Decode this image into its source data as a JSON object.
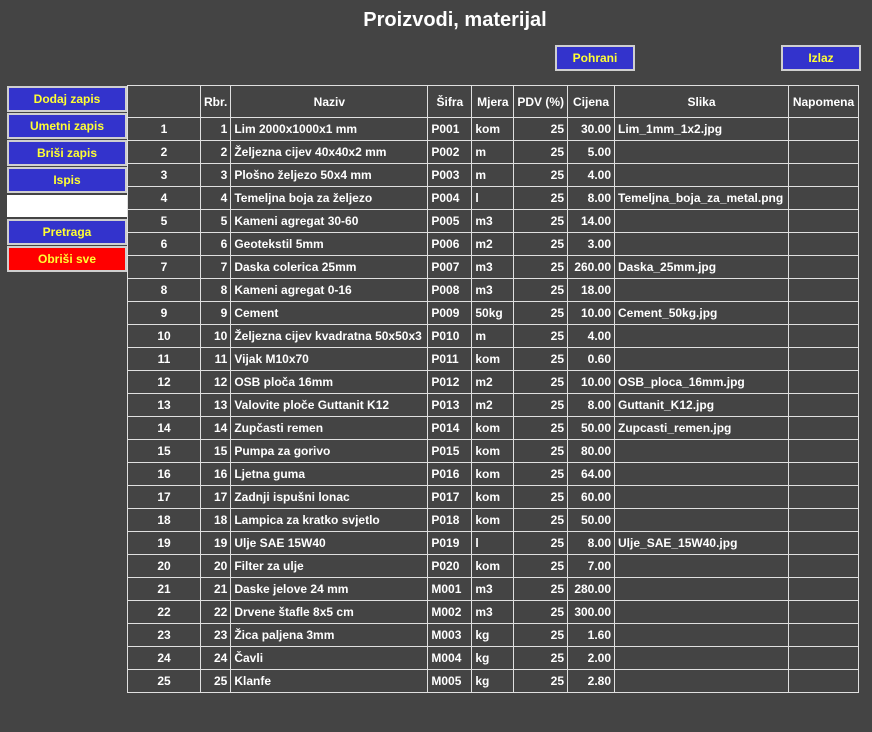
{
  "title": "Proizvodi, materijal",
  "buttons": {
    "save": "Pohrani",
    "exit": "Izlaz"
  },
  "sidebar": {
    "add": "Dodaj zapis",
    "insert": "Umetni zapis",
    "delete": "Briši zapis",
    "print": "Ispis",
    "search_value": "",
    "search": "Pretraga",
    "clear_all": "Obriši sve"
  },
  "colors": {
    "background": "#444444",
    "button": "#3333cc",
    "button_text": "#ffff33",
    "danger": "#ff0000"
  },
  "table": {
    "headers": [
      "",
      "Rbr.",
      "Naziv",
      "Šifra",
      "Mjera",
      "PDV (%)",
      "Cijena",
      "Slika",
      "Napomena"
    ],
    "rows": [
      [
        "1",
        "1",
        "Lim 2000x1000x1 mm",
        "P001",
        "kom",
        "25",
        "30.00",
        "Lim_1mm_1x2.jpg",
        ""
      ],
      [
        "2",
        "2",
        "Željezna cijev 40x40x2 mm",
        "P002",
        "m",
        "25",
        "5.00",
        "",
        ""
      ],
      [
        "3",
        "3",
        "Plošno željezo 50x4 mm",
        "P003",
        "m",
        "25",
        "4.00",
        "",
        ""
      ],
      [
        "4",
        "4",
        "Temeljna boja za željezo",
        "P004",
        "l",
        "25",
        "8.00",
        "Temeljna_boja_za_metal.png",
        ""
      ],
      [
        "5",
        "5",
        "Kameni agregat 30-60",
        "P005",
        "m3",
        "25",
        "14.00",
        "",
        ""
      ],
      [
        "6",
        "6",
        "Geotekstil 5mm",
        "P006",
        "m2",
        "25",
        "3.00",
        "",
        ""
      ],
      [
        "7",
        "7",
        "Daska colerica 25mm",
        "P007",
        "m3",
        "25",
        "260.00",
        "Daska_25mm.jpg",
        ""
      ],
      [
        "8",
        "8",
        "Kameni agregat 0-16",
        "P008",
        "m3",
        "25",
        "18.00",
        "",
        ""
      ],
      [
        "9",
        "9",
        "Cement",
        "P009",
        "50kg",
        "25",
        "10.00",
        "Cement_50kg.jpg",
        ""
      ],
      [
        "10",
        "10",
        "Željezna cijev kvadratna 50x50x3",
        "P010",
        "m",
        "25",
        "4.00",
        "",
        ""
      ],
      [
        "11",
        "11",
        "Vijak M10x70",
        "P011",
        "kom",
        "25",
        "0.60",
        "",
        ""
      ],
      [
        "12",
        "12",
        "OSB ploča 16mm",
        "P012",
        "m2",
        "25",
        "10.00",
        "OSB_ploca_16mm.jpg",
        ""
      ],
      [
        "13",
        "13",
        "Valovite ploče Guttanit K12",
        "P013",
        "m2",
        "25",
        "8.00",
        "Guttanit_K12.jpg",
        ""
      ],
      [
        "14",
        "14",
        "Zupčasti remen",
        "P014",
        "kom",
        "25",
        "50.00",
        "Zupcasti_remen.jpg",
        ""
      ],
      [
        "15",
        "15",
        "Pumpa za gorivo",
        "P015",
        "kom",
        "25",
        "80.00",
        "",
        ""
      ],
      [
        "16",
        "16",
        "Ljetna guma",
        "P016",
        "kom",
        "25",
        "64.00",
        "",
        ""
      ],
      [
        "17",
        "17",
        "Zadnji ispušni lonac",
        "P017",
        "kom",
        "25",
        "60.00",
        "",
        ""
      ],
      [
        "18",
        "18",
        "Lampica za kratko svjetlo",
        "P018",
        "kom",
        "25",
        "50.00",
        "",
        ""
      ],
      [
        "19",
        "19",
        "Ulje SAE 15W40",
        "P019",
        "l",
        "25",
        "8.00",
        "Ulje_SAE_15W40.jpg",
        ""
      ],
      [
        "20",
        "20",
        "Filter za ulje",
        "P020",
        "kom",
        "25",
        "7.00",
        "",
        ""
      ],
      [
        "21",
        "21",
        "Daske jelove 24 mm",
        "M001",
        "m3",
        "25",
        "280.00",
        "",
        ""
      ],
      [
        "22",
        "22",
        "Drvene štafle 8x5 cm",
        "M002",
        "m3",
        "25",
        "300.00",
        "",
        ""
      ],
      [
        "23",
        "23",
        "Žica paljena 3mm",
        "M003",
        "kg",
        "25",
        "1.60",
        "",
        ""
      ],
      [
        "24",
        "24",
        "Čavli",
        "M004",
        "kg",
        "25",
        "2.00",
        "",
        ""
      ],
      [
        "25",
        "25",
        "Klanfe",
        "M005",
        "kg",
        "25",
        "2.80",
        "",
        ""
      ]
    ]
  }
}
